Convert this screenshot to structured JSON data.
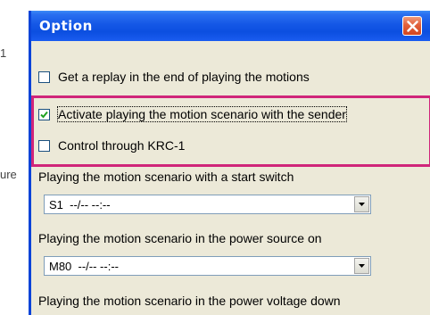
{
  "edge_text": {
    "fragment_1": "1",
    "fragment_2": "ure"
  },
  "dialog": {
    "title": "Option",
    "close_icon": "close-icon"
  },
  "options": {
    "replay": {
      "label": "Get a replay in the end of playing the motions",
      "checked": false
    },
    "sender": {
      "label": "Activate playing the motion scenario with the sender",
      "checked": true
    },
    "krc": {
      "label": "Control through KRC-1",
      "checked": false
    }
  },
  "start_switch": {
    "label": "Playing the motion scenario with a start switch",
    "value": "S1  --/-- --:--"
  },
  "power_on": {
    "label": "Playing the motion scenario in the power source on",
    "value": "M80  --/-- --:--"
  },
  "voltage_down": {
    "label": "Playing the motion scenario in the power voltage down"
  },
  "colors": {
    "titlebar": "#0c4fe0",
    "dialog_bg": "#ece9d8",
    "highlight": "#d0257a",
    "close_button": "#e1603b"
  }
}
